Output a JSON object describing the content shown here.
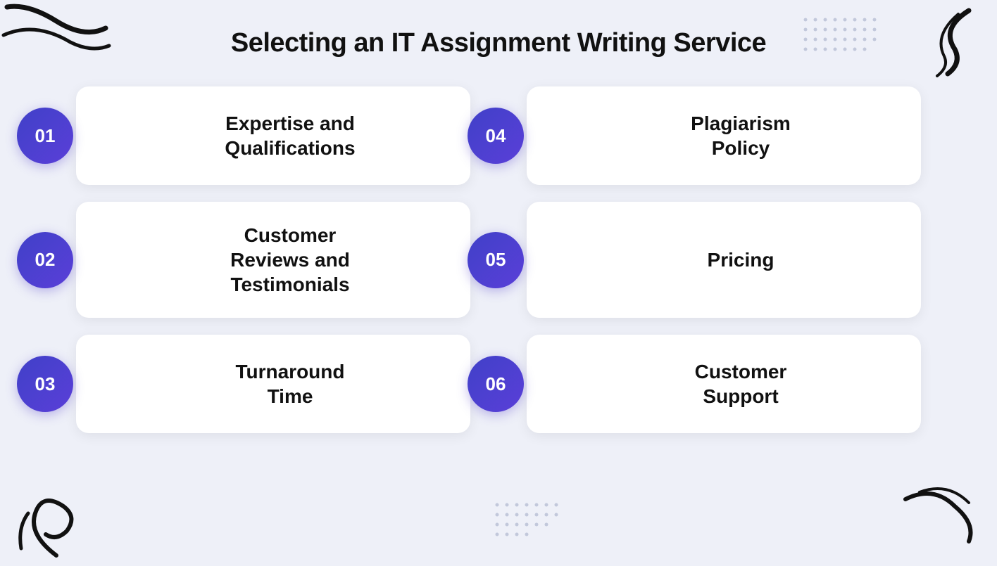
{
  "page": {
    "title": "Selecting an IT Assignment Writing Service",
    "background_color": "#eef0f8",
    "accent_color": "#4545cc"
  },
  "cards": [
    {
      "id": "01",
      "label": "Expertise and\nQualifications"
    },
    {
      "id": "04",
      "label": "Plagiarism\nPolicy"
    },
    {
      "id": "02",
      "label": "Customer\nReviews and\nTestimonials"
    },
    {
      "id": "05",
      "label": "Pricing"
    },
    {
      "id": "03",
      "label": "Turnaround\nTime"
    },
    {
      "id": "06",
      "label": "Customer\nSupport"
    }
  ]
}
